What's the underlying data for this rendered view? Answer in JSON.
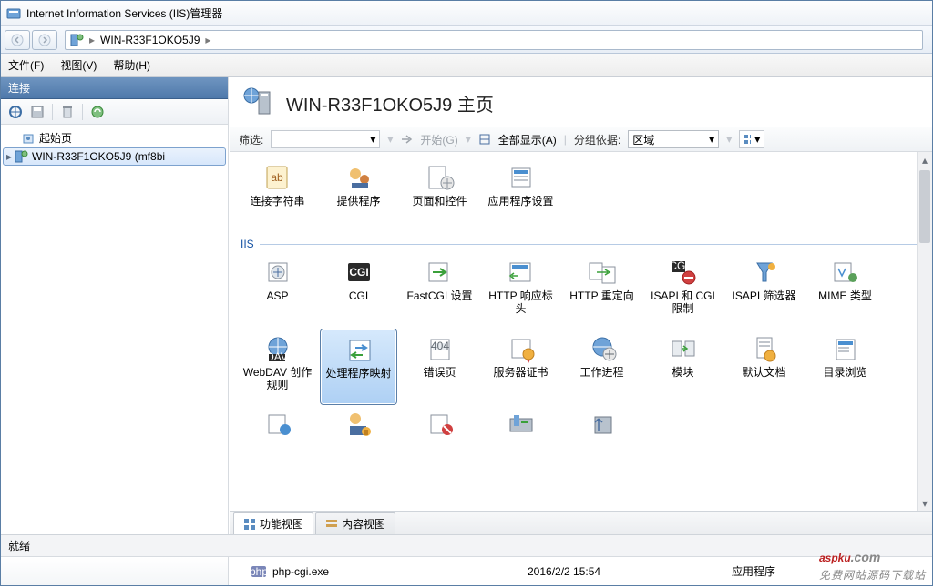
{
  "window": {
    "title": "Internet Information Services (IIS)管理器"
  },
  "breadcrumb": {
    "server": "WIN-R33F1OKO5J9"
  },
  "menu": {
    "file": "文件(F)",
    "view": "视图(V)",
    "help": "帮助(H)"
  },
  "sidebar": {
    "header": "连接",
    "items": [
      {
        "label": "起始页"
      },
      {
        "label": "WIN-R33F1OKO5J9 (mf8bi"
      }
    ]
  },
  "page": {
    "title": "WIN-R33F1OKO5J9 主页"
  },
  "filter": {
    "filter_label": "筛选:",
    "go": "开始(G)",
    "showall": "全部显示(A)",
    "groupby": "分组依据:",
    "group_value": "区域"
  },
  "groups": {
    "iis": "IIS"
  },
  "features_top": [
    {
      "label": "连接字符串"
    },
    {
      "label": "提供程序"
    },
    {
      "label": "页面和控件"
    },
    {
      "label": "应用程序设置"
    }
  ],
  "features_iis1": [
    {
      "label": "ASP"
    },
    {
      "label": "CGI"
    },
    {
      "label": "FastCGI 设置"
    },
    {
      "label": "HTTP 响应标头"
    },
    {
      "label": "HTTP 重定向"
    },
    {
      "label": "ISAPI 和 CGI 限制"
    },
    {
      "label": "ISAPI 筛选器"
    },
    {
      "label": "MIME 类型"
    }
  ],
  "features_iis2": [
    {
      "label": "WebDAV 创作规则"
    },
    {
      "label": "处理程序映射",
      "selected": true
    },
    {
      "label": "错误页"
    },
    {
      "label": "服务器证书"
    },
    {
      "label": "工作进程"
    },
    {
      "label": "模块"
    },
    {
      "label": "默认文档"
    },
    {
      "label": "目录浏览"
    }
  ],
  "tabs": {
    "features_view": "功能视图",
    "content_view": "内容视图"
  },
  "status": {
    "ready": "就绪"
  },
  "bottom": {
    "filename": "php-cgi.exe",
    "date": "2016/2/2 15:54",
    "type": "应用程序"
  },
  "watermark": {
    "brand": "aspku",
    "suffix": ".com",
    "sub": "免费网站源码下载站"
  }
}
